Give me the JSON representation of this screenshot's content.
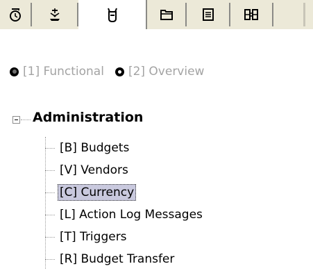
{
  "tabs": [
    {
      "icon": "clock-icon",
      "glyph": "⏀",
      "active": false
    },
    {
      "icon": "compass-icon",
      "glyph": "",
      "active": false
    },
    {
      "icon": "flask-icon",
      "glyph": "",
      "active": true
    },
    {
      "icon": "folder-icon",
      "glyph": "",
      "active": false
    },
    {
      "icon": "list-icon",
      "glyph": "",
      "active": false
    },
    {
      "icon": "binoculars-icon",
      "glyph": "",
      "active": false
    }
  ],
  "view_options": {
    "functional_label": "[1] Functional",
    "overview_label": "[2] Overview",
    "selected": "functional"
  },
  "tree": {
    "root_label": "Administration",
    "expanded": true,
    "items": [
      {
        "label": "[B] Budgets",
        "selected": false
      },
      {
        "label": "[V] Vendors",
        "selected": false
      },
      {
        "label": "[C] Currency",
        "selected": true
      },
      {
        "label": "[L] Action Log Messages",
        "selected": false
      },
      {
        "label": "[T] Triggers",
        "selected": false
      },
      {
        "label": "[R] Budget Transfer",
        "selected": false
      }
    ]
  },
  "colors": {
    "tabstrip_bg": "#ece9d8",
    "disabled_text": "#a3a3a3",
    "selection_bg": "#c9c9de"
  }
}
